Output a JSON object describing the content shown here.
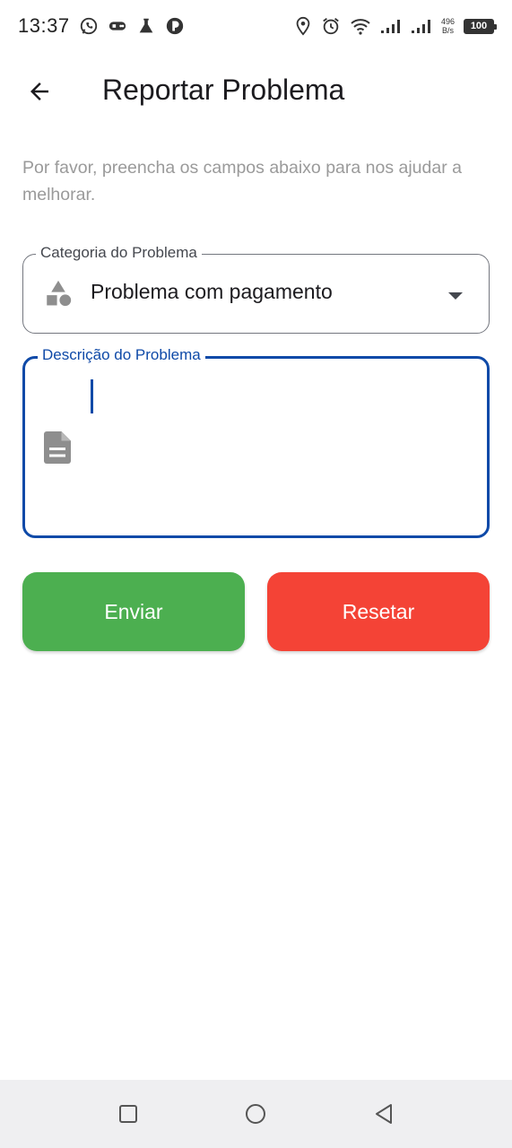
{
  "status_bar": {
    "time": "13:37",
    "net_speed_value": "496",
    "net_speed_unit": "B/s",
    "battery": "100",
    "icons": [
      "whatsapp-icon",
      "game-controller-icon",
      "flask-icon",
      "app-notification-icon",
      "location-icon",
      "alarm-icon",
      "wifi-icon",
      "signal-icon",
      "signal-icon",
      "battery-icon"
    ]
  },
  "app_bar": {
    "back_icon": "arrow-left-icon",
    "title": "Reportar Problema"
  },
  "instructions": "Por favor, preencha os campos abaixo para nos ajudar a melhorar.",
  "category_field": {
    "label": "Categoria do Problema",
    "value": "Problema com pagamento",
    "icon": "category-shapes-icon",
    "trailing_icon": "arrow-drop-down-icon"
  },
  "description_field": {
    "label": "Descrição do Problema",
    "value": "",
    "icon": "description-icon"
  },
  "buttons": {
    "send": "Enviar",
    "reset": "Resetar"
  },
  "colors": {
    "primary": "#0f4aa8",
    "send_button": "#4caf50",
    "reset_button": "#f44336",
    "instructions_text": "#9a9a9a"
  },
  "nav_bar": {
    "icons": [
      "recent-apps-icon",
      "home-icon",
      "back-icon"
    ]
  }
}
